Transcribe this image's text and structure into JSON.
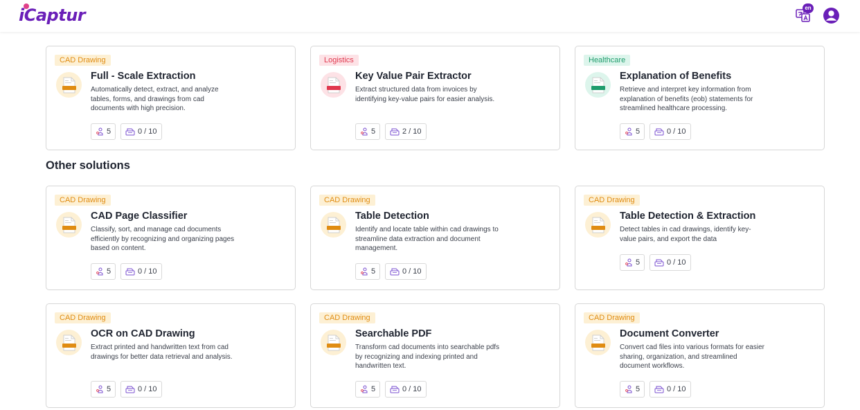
{
  "header": {
    "logo_text": "iCaptur",
    "lang_badge": "en",
    "lang_icon": "translate-icon",
    "user_icon": "user-avatar-icon"
  },
  "section": {
    "other_title": "Other solutions"
  },
  "colors": {
    "brand": "#6a1fb8",
    "cad": "#e08c12",
    "logistics": "#e0384e",
    "healthcare": "#1e9c6c"
  },
  "featured": [
    {
      "tag": "CAD Drawing",
      "icon_label": "CAD",
      "title": "Full - Scale Extraction",
      "desc": "Automatically detect, extract, and analyze tables, forms, and drawings from cad documents with high precision.",
      "users": "5",
      "usage": "0 / 10"
    },
    {
      "tag": "Logistics",
      "icon_label": "LOGISTICS",
      "title": "Key Value Pair Extractor",
      "desc": "Extract structured data from invoices by identifying key-value pairs for easier analysis.",
      "users": "5",
      "usage": "2 / 10"
    },
    {
      "tag": "Healthcare",
      "icon_label": "HEALTHCARE",
      "title": "Explanation of Benefits",
      "desc": "Retrieve and interpret key information from explanation of benefits (eob) statements for streamlined healthcare processing.",
      "users": "5",
      "usage": "0 / 10"
    }
  ],
  "others": [
    {
      "tag": "CAD Drawing",
      "icon_label": "CAD",
      "title": "CAD Page Classifier",
      "desc": "Classify, sort, and manage cad documents efficiently by recognizing and organizing pages based on content.",
      "users": "5",
      "usage": "0 / 10"
    },
    {
      "tag": "CAD Drawing",
      "icon_label": "CAD",
      "title": "Table Detection",
      "desc": "Identify and locate table within cad drawings to streamline data extraction and document management.",
      "users": "5",
      "usage": "0 / 10"
    },
    {
      "tag": "CAD Drawing",
      "icon_label": "CAD",
      "title": "Table Detection & Extraction",
      "desc": "Detect tables in cad drawings, identify key-value pairs, and export the data",
      "users": "5",
      "usage": "0 / 10"
    },
    {
      "tag": "CAD Drawing",
      "icon_label": "CAD",
      "title": "OCR on CAD Drawing",
      "desc": "Extract printed and handwritten text from cad drawings for better data retrieval and analysis.",
      "users": "5",
      "usage": "0 / 10"
    },
    {
      "tag": "CAD Drawing",
      "icon_label": "CAD",
      "title": "Searchable PDF",
      "desc": "Transform cad documents into searchable pdfs by recognizing and indexing printed and handwritten text.",
      "users": "5",
      "usage": "0 / 10"
    },
    {
      "tag": "CAD Drawing",
      "icon_label": "CAD",
      "title": "Document Converter",
      "desc": "Convert cad files into various formats for easier sharing, organization, and streamlined document workflows.",
      "users": "5",
      "usage": "0 / 10"
    }
  ]
}
